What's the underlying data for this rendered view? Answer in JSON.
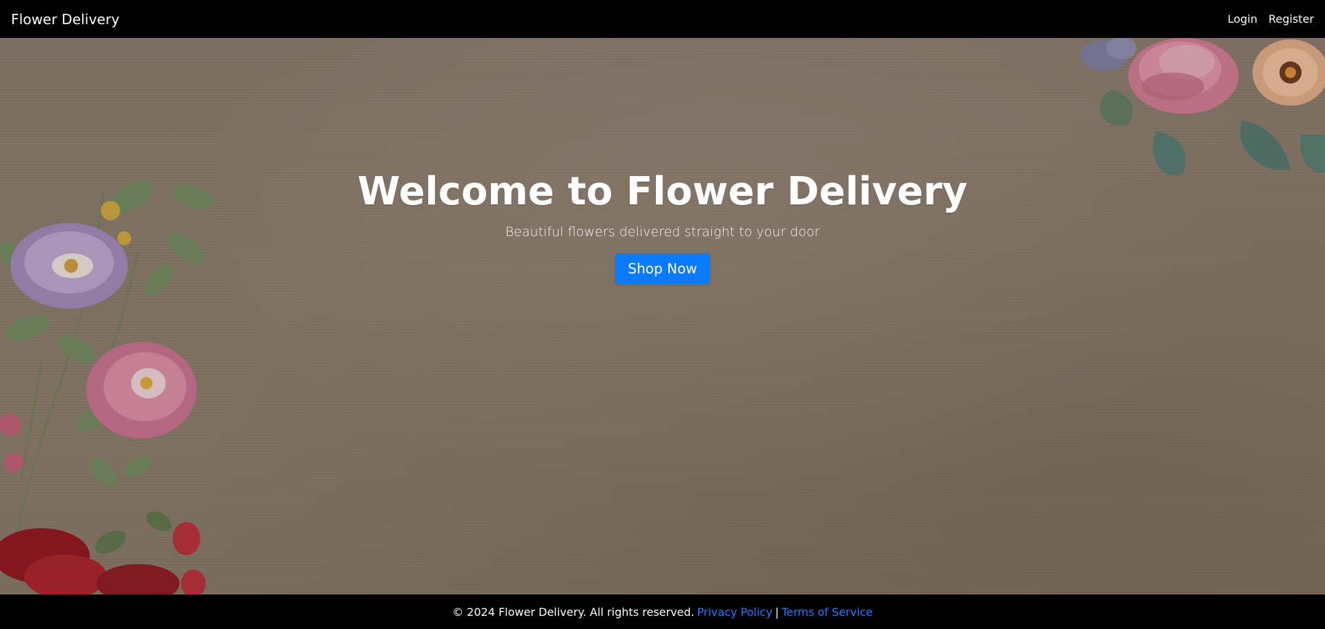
{
  "navbar": {
    "brand": "Flower Delivery",
    "links": [
      {
        "label": "Login"
      },
      {
        "label": "Register"
      }
    ]
  },
  "hero": {
    "title": "Welcome to Flower Delivery",
    "subtitle": "Beautiful flowers delivered straight to your door",
    "cta_label": "Shop Now"
  },
  "footer": {
    "copyright": "© 2024 Flower Delivery. All rights reserved.",
    "privacy_label": "Privacy Policy",
    "separator": "|",
    "terms_label": "Terms of Service"
  },
  "colors": {
    "navbar_bg": "#000000",
    "cta_bg": "#0b7bfd",
    "footer_link": "#1c7cff"
  }
}
